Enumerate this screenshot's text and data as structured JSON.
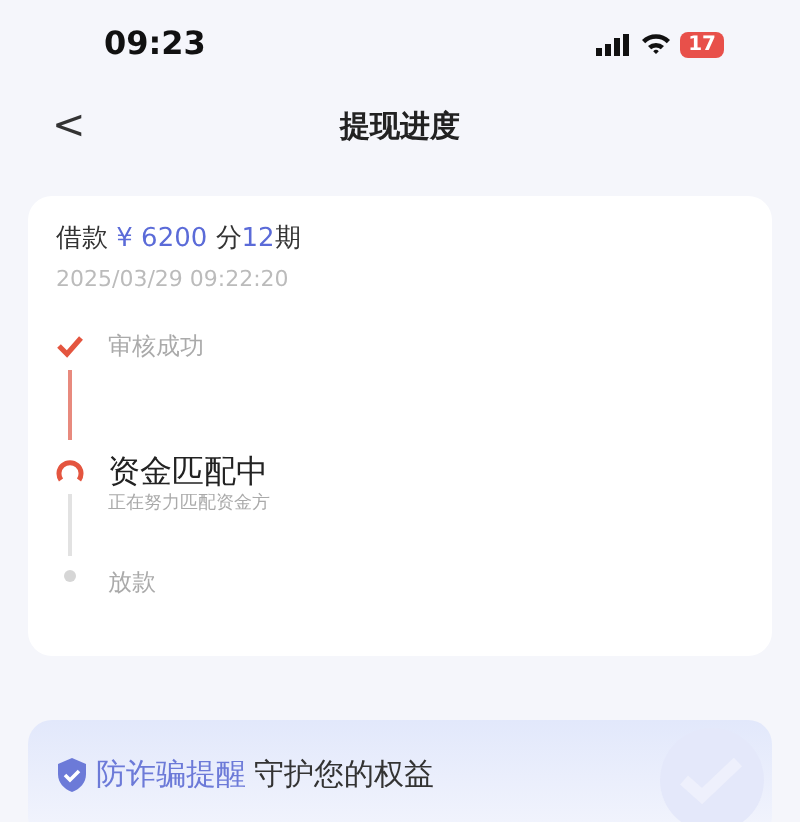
{
  "status_bar": {
    "time": "09:23",
    "battery": "17"
  },
  "nav": {
    "back": "<",
    "title": "提现进度"
  },
  "loan": {
    "label": "借款",
    "amount": "¥ 6200",
    "mid": "分",
    "periods": "12",
    "unit": "期",
    "date": "2025/03/29 09:22:20"
  },
  "steps": [
    {
      "kind": "done",
      "title": "审核成功"
    },
    {
      "kind": "active",
      "title": "资金匹配中",
      "subtitle": "正在努力匹配资金方"
    },
    {
      "kind": "pending",
      "title": "放款"
    }
  ],
  "banner": {
    "highlight": "防诈骗提醒",
    "text": "守护您的权益"
  }
}
